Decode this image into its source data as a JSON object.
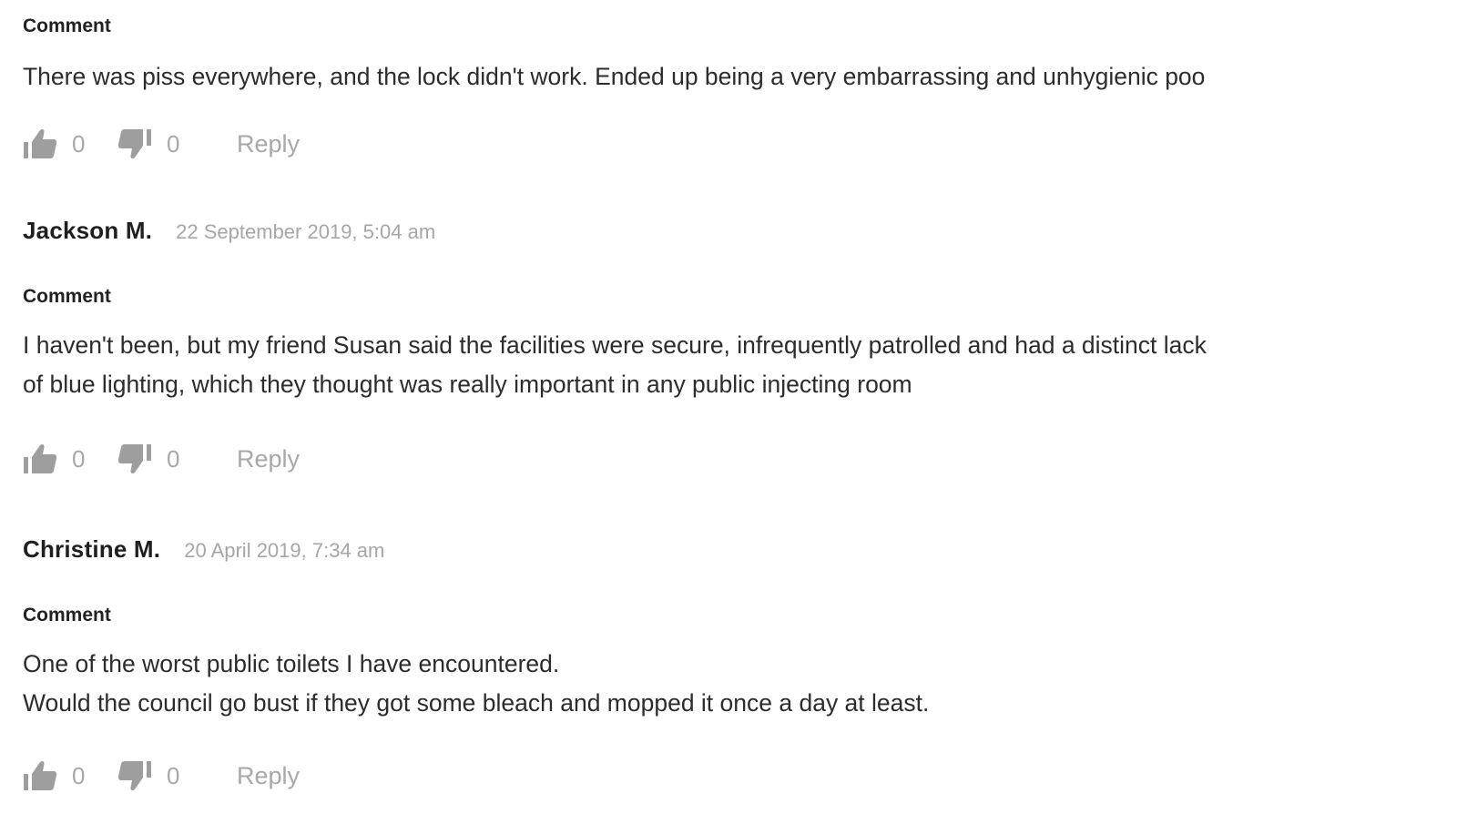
{
  "comments": [
    {
      "section_label": "Comment",
      "body": [
        "There was piss everywhere, and the lock didn't work. Ended up being a very embarrassing and unhygienic poo"
      ],
      "likes": "0",
      "dislikes": "0",
      "reply_label": "Reply"
    },
    {
      "author": "Jackson M.",
      "timestamp": "22 September 2019, 5:04 am",
      "section_label": "Comment",
      "body": [
        "I haven't been, but my friend Susan said the facilities were secure, infrequently patrolled and had a distinct lack",
        "of blue lighting, which they thought was really important in any public injecting room"
      ],
      "likes": "0",
      "dislikes": "0",
      "reply_label": "Reply"
    },
    {
      "author": "Christine M.",
      "timestamp": "20 April 2019, 7:34 am",
      "section_label": "Comment",
      "body": [
        "One of the worst public toilets I have encountered.",
        "Would the council go bust if they got some bleach and mopped it once a day at least."
      ],
      "likes": "0",
      "dislikes": "0",
      "reply_label": "Reply"
    }
  ],
  "icons": {
    "like": "thumbs-up-icon",
    "dislike": "thumbs-down-icon"
  },
  "colors": {
    "text": "#2c2c2c",
    "muted": "#a8a8a8",
    "icon": "#9e9e9e"
  }
}
